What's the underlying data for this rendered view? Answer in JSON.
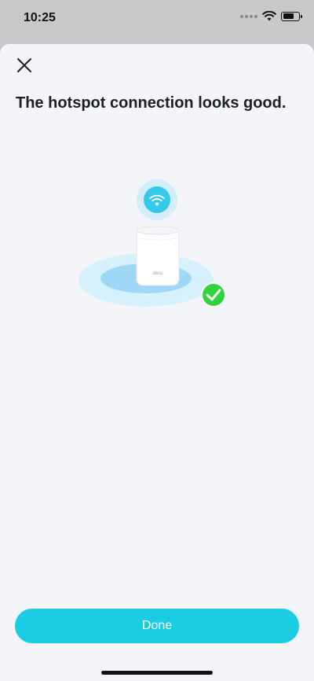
{
  "status_bar": {
    "time": "10:25",
    "icons": [
      "signal-dots-icon",
      "wifi-icon",
      "battery-icon"
    ]
  },
  "sheet": {
    "title": "The hotspot connection looks good.",
    "close_icon": "close-icon",
    "illustration": {
      "device_label": "deco",
      "icons": [
        "wifi-icon",
        "deco-device-icon",
        "checkmark-icon"
      ]
    },
    "done_label": "Done"
  },
  "colors": {
    "accent": "#1bcde3",
    "success": "#2ed43a",
    "background": "#f4f5f9",
    "title_text": "#1c1f24"
  }
}
